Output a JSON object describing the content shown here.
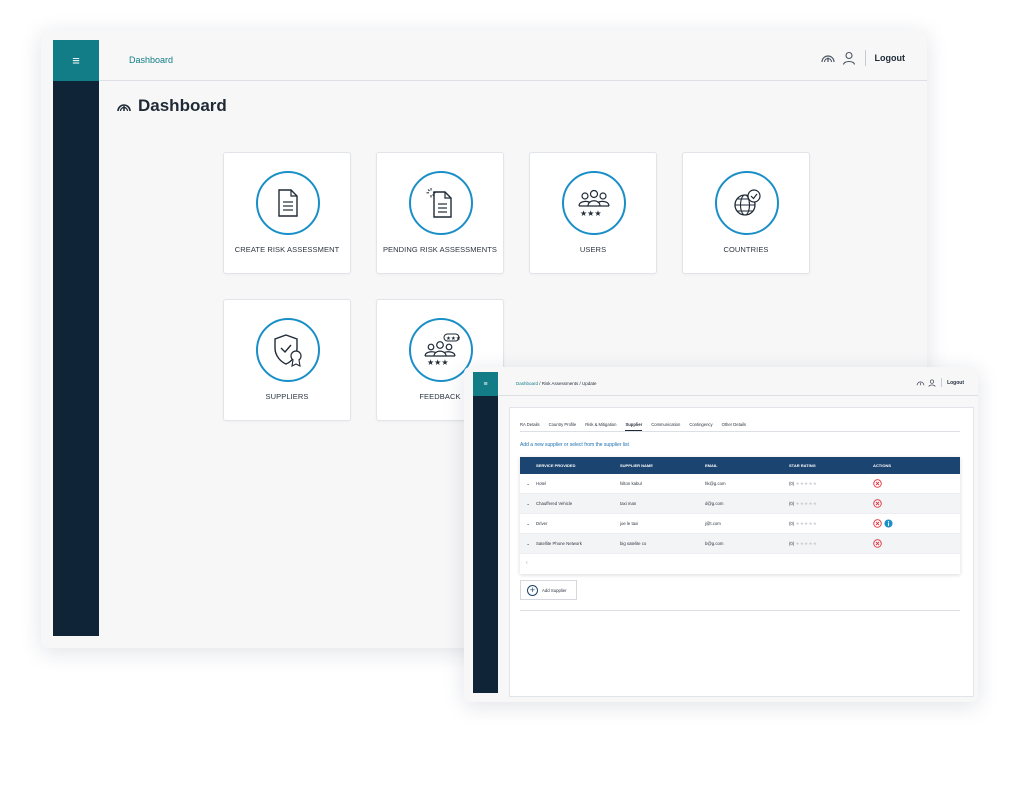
{
  "dashboard": {
    "header": {
      "breadcrumb": "Dashboard",
      "logout_label": "Logout",
      "icons": [
        "speedometer-icon",
        "user-icon"
      ]
    },
    "page_title": "Dashboard",
    "cards": [
      {
        "label": "CREATE RISK ASSESSMENT",
        "icon": "document-icon"
      },
      {
        "label": "PENDING RISK ASSESSMENTS",
        "icon": "pending-document-icon"
      },
      {
        "label": "USERS",
        "icon": "users-icon"
      },
      {
        "label": "COUNTRIES",
        "icon": "globe-icon"
      },
      {
        "label": "SUPPLIERS",
        "icon": "shield-badge-icon"
      },
      {
        "label": "FEEDBACK",
        "icon": "feedback-icon"
      }
    ]
  },
  "update": {
    "breadcrumb": {
      "home": "Dashboard",
      "rest": " / Risk Assessments / Update"
    },
    "logout_label": "Logout",
    "tabs": [
      "RA Details",
      "Country Profile",
      "Risk & Mitigation",
      "Supplier",
      "Communication",
      "Contingency",
      "Other Details"
    ],
    "active_tab": "Supplier",
    "subheading": "Add a new supplier or select from the supplier list",
    "table": {
      "columns": [
        "SERVICE PROVIDED",
        "SUPPLIER NAME",
        "EMAIL",
        "STAR RATING",
        "ACTIONS"
      ],
      "rows": [
        {
          "service": "Hotel",
          "name": "hilton kabul",
          "email": "hk@g.com",
          "rating": "(0)",
          "actions": [
            "remove"
          ]
        },
        {
          "service": "Chauffered Vehicle",
          "name": "taxi man",
          "email": "d@g.com",
          "rating": "(0)",
          "actions": [
            "remove"
          ]
        },
        {
          "service": "Driver",
          "name": "joe le taxi",
          "email": "j@t.com",
          "rating": "(0)",
          "actions": [
            "remove",
            "info"
          ]
        },
        {
          "service": "Satellite Phone Network",
          "name": "big satelite co",
          "email": "b@g.com",
          "rating": "(0)",
          "actions": [
            "remove"
          ]
        }
      ],
      "footer": "‹"
    },
    "add_button_label": "Add Supplier"
  },
  "colors": {
    "teal": "#127d86",
    "navy": "#0f2437",
    "accent_blue": "#1a8fc7",
    "table_header": "#1b4470",
    "remove_red": "#e0303a"
  }
}
